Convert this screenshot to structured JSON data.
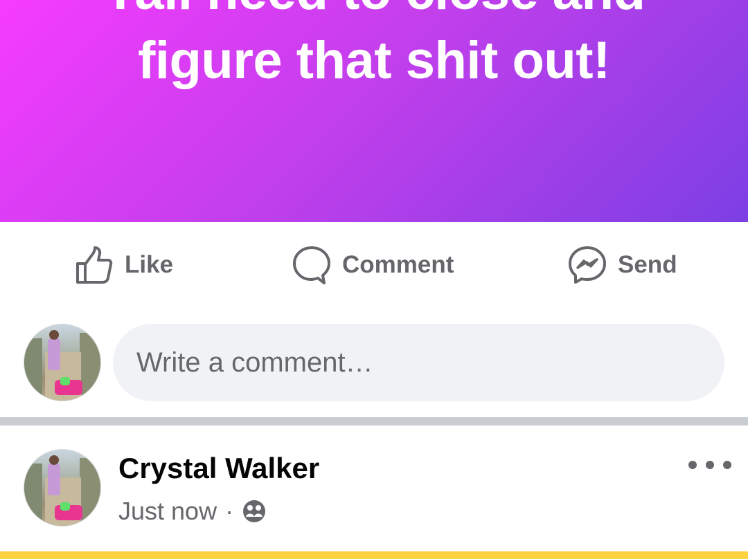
{
  "post": {
    "banner_lines": [
      "Yall need to close and",
      "figure that shit out!"
    ],
    "banner_colors": [
      "#f63bff",
      "#7c3fe4"
    ]
  },
  "actions": {
    "like_label": "Like",
    "comment_label": "Comment",
    "send_label": "Send",
    "like_icon": "thumbs-up-icon",
    "comment_icon": "comment-bubble-icon",
    "send_icon": "messenger-icon"
  },
  "composer": {
    "placeholder": "Write a comment…",
    "avatar_icon": "avatar"
  },
  "next_post": {
    "author": "Crystal Walker",
    "timestamp": "Just now",
    "separator": "·",
    "audience_icon": "friends-icon",
    "more_icon": "more-options-icon",
    "next_banner_color": "#fcd240"
  }
}
